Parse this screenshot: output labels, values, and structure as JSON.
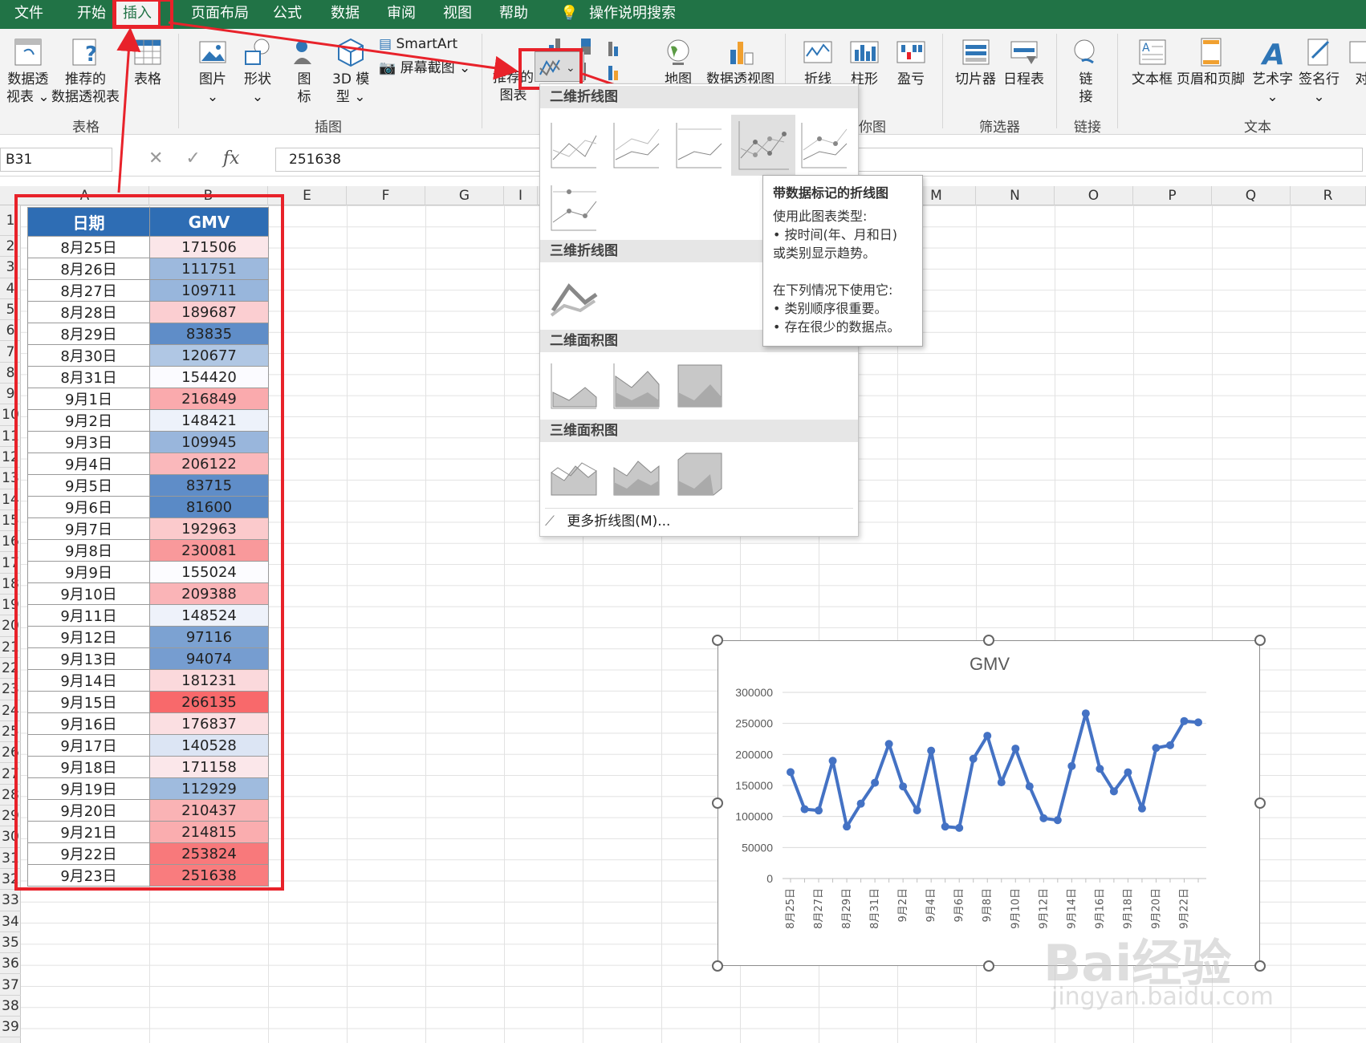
{
  "menu": {
    "tabs": [
      "文件",
      "开始",
      "插入",
      "页面布局",
      "公式",
      "数据",
      "审阅",
      "视图",
      "帮助"
    ],
    "search": "操作说明搜索"
  },
  "ribbon": {
    "buttons": {
      "pivot": "数据透\n视表 ⌄",
      "rec_pivot": "推荐的\n数据透视表",
      "table": "表格",
      "picture": "图片\n⌄",
      "shapes": "形状\n⌄",
      "icons": "图\n标",
      "model3d": "3D 模\n型 ⌄",
      "smartart": "SmartArt",
      "screenshot": "屏幕截图 ⌄",
      "rec_chart": "推荐的\n图表",
      "map": "地图",
      "pivotchart": "数据透视图",
      "spark_line": "折线",
      "spark_col": "柱形",
      "spark_wl": "盈亏",
      "slicer": "切片器",
      "timeline": "日程表",
      "link": "链\n接",
      "textbox": "文本框",
      "header": "页眉和页脚",
      "wordart": "艺术字\n⌄",
      "signature": "签名行\n⌄",
      "object": "对"
    },
    "groups": {
      "tables": "表格",
      "illustrations": "插图",
      "sparklines": "你图",
      "filters": "筛选器",
      "links": "链接",
      "text": "文本"
    }
  },
  "formula_bar": {
    "name_box": "B31",
    "fx": "fx",
    "value": "251638"
  },
  "columns": [
    "A",
    "B",
    "E",
    "F",
    "G",
    "I",
    "M",
    "N",
    "O",
    "P",
    "Q",
    "R"
  ],
  "rows": [
    "1",
    "2",
    "3",
    "4",
    "5",
    "6",
    "7",
    "8",
    "9",
    "10",
    "11",
    "12",
    "13",
    "14",
    "15",
    "16",
    "17",
    "18",
    "19",
    "20",
    "21",
    "22",
    "23",
    "24",
    "25",
    "26",
    "27",
    "28",
    "29",
    "30",
    "31",
    "32",
    "33",
    "34",
    "35",
    "36",
    "37",
    "38",
    "39"
  ],
  "table": {
    "headers": [
      "日期",
      "GMV"
    ],
    "rows": [
      [
        "8月25日",
        "171506"
      ],
      [
        "8月26日",
        "111751"
      ],
      [
        "8月27日",
        "109711"
      ],
      [
        "8月28日",
        "189687"
      ],
      [
        "8月29日",
        "83835"
      ],
      [
        "8月30日",
        "120677"
      ],
      [
        "8月31日",
        "154420"
      ],
      [
        "9月1日",
        "216849"
      ],
      [
        "9月2日",
        "148421"
      ],
      [
        "9月3日",
        "109945"
      ],
      [
        "9月4日",
        "206122"
      ],
      [
        "9月5日",
        "83715"
      ],
      [
        "9月6日",
        "81600"
      ],
      [
        "9月7日",
        "192963"
      ],
      [
        "9月8日",
        "230081"
      ],
      [
        "9月9日",
        "155024"
      ],
      [
        "9月10日",
        "209388"
      ],
      [
        "9月11日",
        "148524"
      ],
      [
        "9月12日",
        "97116"
      ],
      [
        "9月13日",
        "94074"
      ],
      [
        "9月14日",
        "181231"
      ],
      [
        "9月15日",
        "266135"
      ],
      [
        "9月16日",
        "176837"
      ],
      [
        "9月17日",
        "140528"
      ],
      [
        "9月18日",
        "171158"
      ],
      [
        "9月19日",
        "112929"
      ],
      [
        "9月20日",
        "210437"
      ],
      [
        "9月21日",
        "214815"
      ],
      [
        "9月22日",
        "253824"
      ],
      [
        "9月23日",
        "251638"
      ]
    ]
  },
  "dropdown": {
    "sections": [
      "二维折线图",
      "三维折线图",
      "二维面积图",
      "三维面积图"
    ],
    "more": "更多折线图(M)..."
  },
  "tooltip": {
    "title": "带数据标记的折线图",
    "lines": [
      "使用此图表类型:",
      "• 按时间(年、月和日)",
      "或类别显示趋势。",
      "",
      "在下列情况下使用它:",
      "• 类别顺序很重要。",
      "• 存在很少的数据点。"
    ]
  },
  "chart_data": {
    "type": "line",
    "title": "GMV",
    "categories": [
      "8月25日",
      "8月26日",
      "8月27日",
      "8月28日",
      "8月29日",
      "8月30日",
      "8月31日",
      "9月1日",
      "9月2日",
      "9月3日",
      "9月4日",
      "9月5日",
      "9月6日",
      "9月7日",
      "9月8日",
      "9月9日",
      "9月10日",
      "9月11日",
      "9月12日",
      "9月13日",
      "9月14日",
      "9月15日",
      "9月16日",
      "9月17日",
      "9月18日",
      "9月19日",
      "9月20日",
      "9月21日",
      "9月22日",
      "9月23日"
    ],
    "tick_labels": [
      "8月25日",
      "8月27日",
      "8月29日",
      "8月31日",
      "9月2日",
      "9月4日",
      "9月6日",
      "9月8日",
      "9月10日",
      "9月12日",
      "9月14日",
      "9月16日",
      "9月18日",
      "9月20日",
      "9月22日"
    ],
    "series": [
      {
        "values": [
          171506,
          111751,
          109711,
          189687,
          83835,
          120677,
          154420,
          216849,
          148421,
          109945,
          206122,
          83715,
          81600,
          192963,
          230081,
          155024,
          209388,
          148524,
          97116,
          94074,
          181231,
          266135,
          176837,
          140528,
          171158,
          112929,
          210437,
          214815,
          253824,
          251638
        ]
      }
    ],
    "ylim": [
      0,
      300000
    ],
    "yticks": [
      "0",
      "50000",
      "100000",
      "150000",
      "200000",
      "250000",
      "300000"
    ],
    "color": "#4472c4",
    "grid": true
  },
  "watermark": {
    "logo": "Bai经验",
    "url": "jingyan.baidu.com"
  }
}
